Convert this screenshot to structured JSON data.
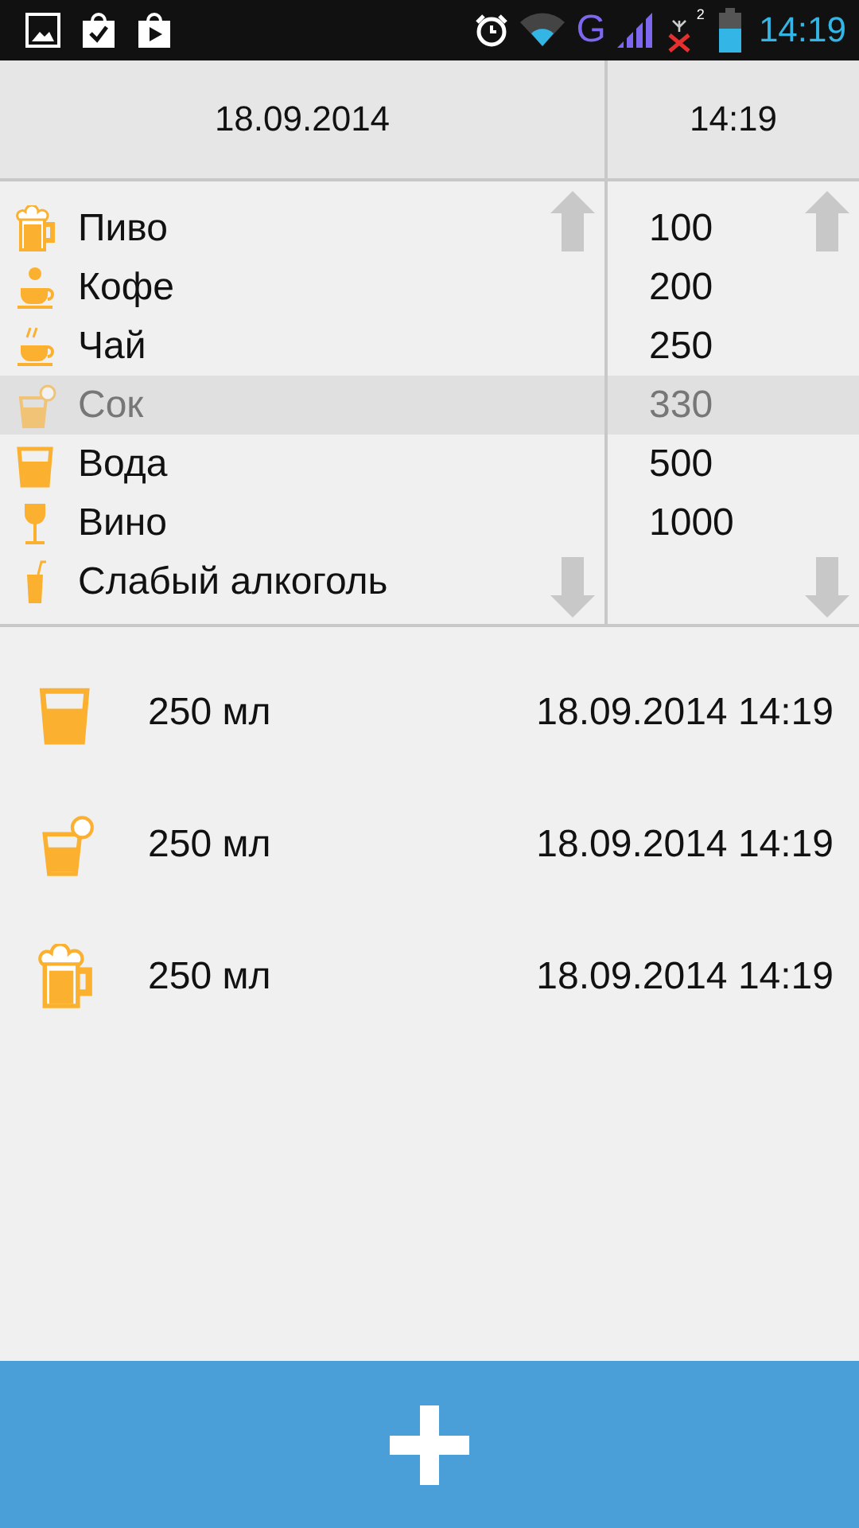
{
  "status_bar": {
    "network_type": "G",
    "time": "14:19",
    "sim_badge": "2"
  },
  "header": {
    "date": "18.09.2014",
    "time": "14:19"
  },
  "drinks": [
    {
      "name": "Пиво",
      "kind": "mug",
      "selected": false
    },
    {
      "name": "Кофе",
      "kind": "coffee",
      "selected": false
    },
    {
      "name": "Чай",
      "kind": "tea",
      "selected": false
    },
    {
      "name": "Сок",
      "kind": "juice",
      "selected": true
    },
    {
      "name": "Вода",
      "kind": "glass",
      "selected": false
    },
    {
      "name": "Вино",
      "kind": "wine",
      "selected": false
    },
    {
      "name": "Слабый алкоголь",
      "kind": "straw",
      "selected": false
    }
  ],
  "volumes": [
    {
      "value": "100",
      "selected": false
    },
    {
      "value": "200",
      "selected": false
    },
    {
      "value": "250",
      "selected": false
    },
    {
      "value": "330",
      "selected": true
    },
    {
      "value": "500",
      "selected": false
    },
    {
      "value": "1000",
      "selected": false
    }
  ],
  "history": [
    {
      "kind": "glass",
      "amount": "250 мл",
      "datetime": "18.09.2014 14:19"
    },
    {
      "kind": "juice",
      "amount": "250 мл",
      "datetime": "18.09.2014 14:19"
    },
    {
      "kind": "mug",
      "amount": "250 мл",
      "datetime": "18.09.2014 14:19"
    }
  ]
}
